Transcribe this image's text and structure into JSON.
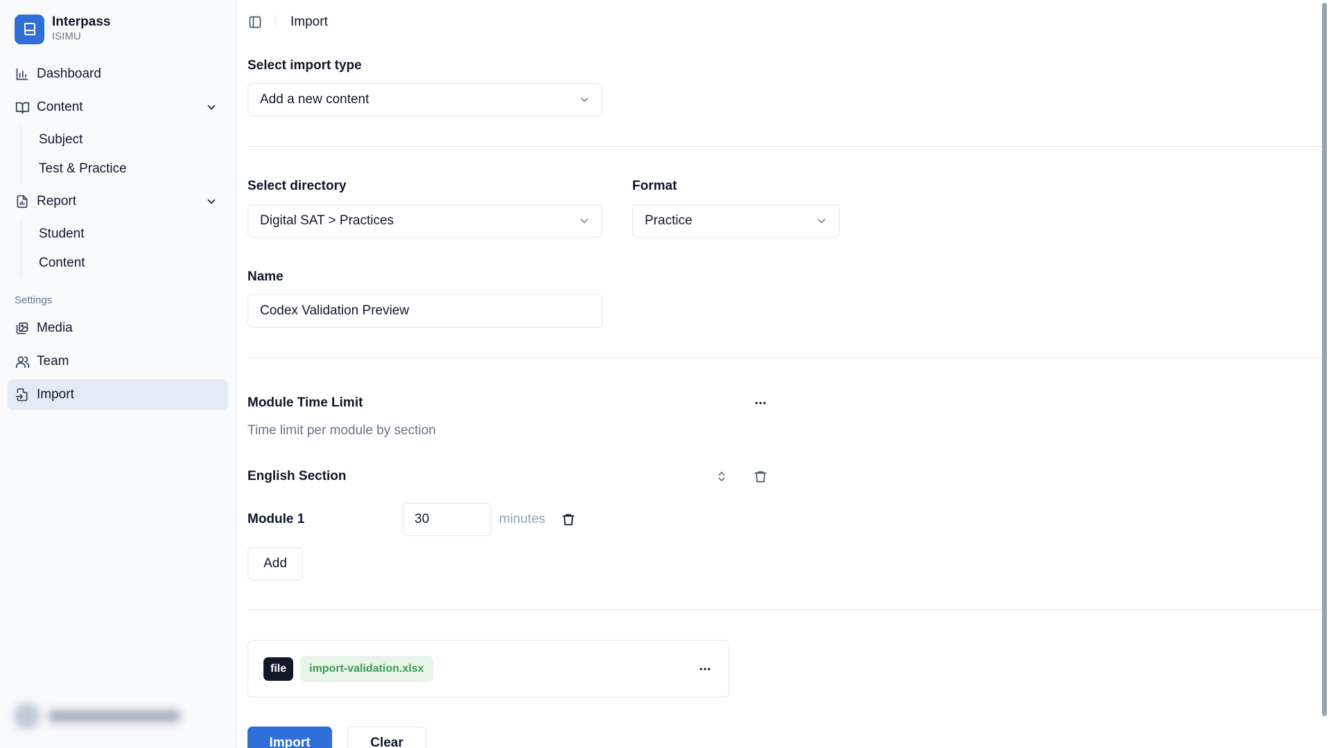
{
  "brand": {
    "name": "Interpass",
    "subtitle": "ISIMU"
  },
  "sidebar": {
    "items": [
      {
        "label": "Dashboard"
      },
      {
        "label": "Content",
        "children": [
          {
            "label": "Subject"
          },
          {
            "label": "Test & Practice"
          }
        ]
      },
      {
        "label": "Report",
        "children": [
          {
            "label": "Student"
          },
          {
            "label": "Content"
          }
        ]
      }
    ],
    "settings_label": "Settings",
    "settings_items": [
      {
        "label": "Media"
      },
      {
        "label": "Team"
      },
      {
        "label": "Import"
      }
    ],
    "active_item": "Import"
  },
  "topbar": {
    "breadcrumb": "Import"
  },
  "form": {
    "import_type": {
      "label": "Select import type",
      "value": "Add a new content"
    },
    "directory": {
      "label": "Select directory",
      "value": "Digital SAT > Practices"
    },
    "format": {
      "label": "Format",
      "value": "Practice"
    },
    "name": {
      "label": "Name",
      "value": "Codex Validation Preview"
    },
    "module_time_limit": {
      "title": "Module Time Limit",
      "description": "Time limit per module by section",
      "section_name": "English Section",
      "modules": [
        {
          "label": "Module 1",
          "value": "30",
          "unit": "minutes"
        }
      ],
      "add_label": "Add"
    },
    "file": {
      "tag": "file",
      "name": "import-validation.xlsx"
    },
    "actions": {
      "import_label": "Import",
      "clear_label": "Clear"
    }
  },
  "colors": {
    "accent": "#2e6fd8",
    "active_bg": "#e3ebf5",
    "file_name_bg": "#e8f5e9",
    "file_name_text": "#3a9a57"
  },
  "icons": {
    "brand": "book-icon",
    "dashboard": "bar-chart-icon",
    "content": "open-book-icon",
    "report": "file-report-icon",
    "media": "images-icon",
    "team": "users-icon",
    "import": "file-import-icon",
    "sidebar_toggle": "panel-left-icon",
    "select_caret": "chevron-down-icon",
    "more": "ellipsis-icon",
    "sort": "chevrons-up-down-icon",
    "delete": "trash-icon"
  }
}
